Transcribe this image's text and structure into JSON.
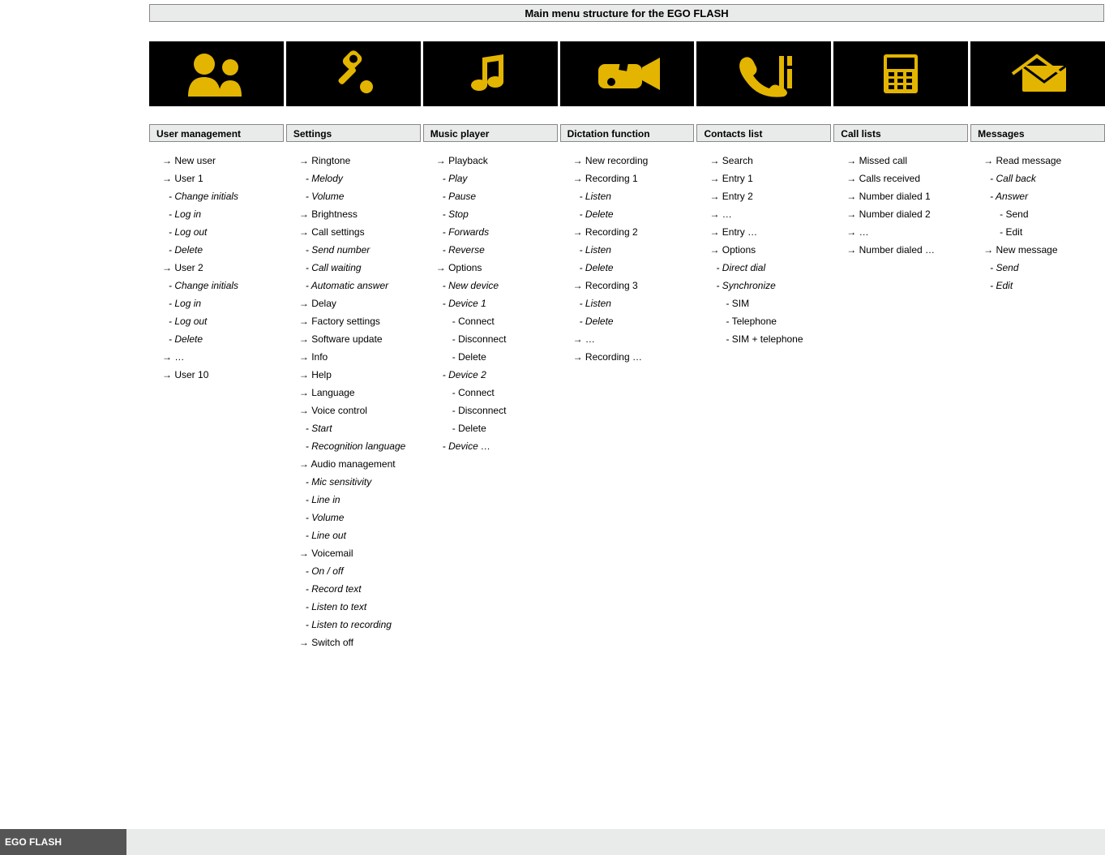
{
  "title": "Main menu structure for the EGO FLASH",
  "footer_label": "EGO FLASH",
  "sections": [
    {
      "header": "User management",
      "icon": "users-icon",
      "items": [
        {
          "t": "New user",
          "l": 0,
          "k": "arrow"
        },
        {
          "t": "User 1",
          "l": 0,
          "k": "arrow"
        },
        {
          "t": "Change initials",
          "l": 1,
          "k": "dash"
        },
        {
          "t": "Log in",
          "l": 1,
          "k": "dash"
        },
        {
          "t": "Log out",
          "l": 1,
          "k": "dash"
        },
        {
          "t": "Delete",
          "l": 1,
          "k": "dash"
        },
        {
          "t": "User 2",
          "l": 0,
          "k": "arrow"
        },
        {
          "t": "Change initials",
          "l": 1,
          "k": "dash"
        },
        {
          "t": "Log in",
          "l": 1,
          "k": "dash"
        },
        {
          "t": "Log out",
          "l": 1,
          "k": "dash"
        },
        {
          "t": "Delete",
          "l": 1,
          "k": "dash"
        },
        {
          "t": "…",
          "l": 0,
          "k": "arrow"
        },
        {
          "t": "User 10",
          "l": 0,
          "k": "arrow"
        }
      ]
    },
    {
      "header": "Settings",
      "icon": "settings-icon",
      "items": [
        {
          "t": "Ringtone",
          "l": 0,
          "k": "arrow"
        },
        {
          "t": "Melody",
          "l": 1,
          "k": "dash"
        },
        {
          "t": "Volume",
          "l": 1,
          "k": "dash"
        },
        {
          "t": "Brightness",
          "l": 0,
          "k": "arrow"
        },
        {
          "t": "Call settings",
          "l": 0,
          "k": "arrow"
        },
        {
          "t": "Send number",
          "l": 1,
          "k": "dash"
        },
        {
          "t": "Call waiting",
          "l": 1,
          "k": "dash"
        },
        {
          "t": "Automatic answer",
          "l": 1,
          "k": "dash"
        },
        {
          "t": "Delay",
          "l": 0,
          "k": "arrow"
        },
        {
          "t": "Factory settings",
          "l": 0,
          "k": "arrow"
        },
        {
          "t": "Software update",
          "l": 0,
          "k": "arrow"
        },
        {
          "t": "Info",
          "l": 0,
          "k": "arrow"
        },
        {
          "t": "Help",
          "l": 0,
          "k": "arrow"
        },
        {
          "t": "Language",
          "l": 0,
          "k": "arrow"
        },
        {
          "t": "Voice control",
          "l": 0,
          "k": "arrow"
        },
        {
          "t": "Start",
          "l": 1,
          "k": "dash"
        },
        {
          "t": "Recognition language",
          "l": 1,
          "k": "dash"
        },
        {
          "t": "Audio management",
          "l": 0,
          "k": "arrow"
        },
        {
          "t": "Mic sensitivity",
          "l": 1,
          "k": "dash"
        },
        {
          "t": "Line in",
          "l": 1,
          "k": "dash"
        },
        {
          "t": "Volume",
          "l": 1,
          "k": "dash"
        },
        {
          "t": "Line out",
          "l": 1,
          "k": "dash"
        },
        {
          "t": "Voicemail",
          "l": 0,
          "k": "arrow"
        },
        {
          "t": "On / off",
          "l": 1,
          "k": "dash"
        },
        {
          "t": "Record text",
          "l": 1,
          "k": "dash"
        },
        {
          "t": "Listen to text",
          "l": 1,
          "k": "dash"
        },
        {
          "t": "Listen to recording",
          "l": 1,
          "k": "dash"
        },
        {
          "t": "Switch off",
          "l": 0,
          "k": "arrow"
        }
      ]
    },
    {
      "header": "Music player",
      "icon": "music-icon",
      "items": [
        {
          "t": "Playback",
          "l": 0,
          "k": "arrow"
        },
        {
          "t": "Play",
          "l": 1,
          "k": "dash"
        },
        {
          "t": "Pause",
          "l": 1,
          "k": "dash"
        },
        {
          "t": "Stop",
          "l": 1,
          "k": "dash"
        },
        {
          "t": "Forwards",
          "l": 1,
          "k": "dash"
        },
        {
          "t": "Reverse",
          "l": 1,
          "k": "dash"
        },
        {
          "t": "Options",
          "l": 0,
          "k": "arrow"
        },
        {
          "t": "New device",
          "l": 1,
          "k": "dash"
        },
        {
          "t": "Device 1",
          "l": 1,
          "k": "dash"
        },
        {
          "t": "Connect",
          "l": 2,
          "k": "dash"
        },
        {
          "t": "Disconnect",
          "l": 2,
          "k": "dash"
        },
        {
          "t": "Delete",
          "l": 2,
          "k": "dash"
        },
        {
          "t": "Device 2",
          "l": 1,
          "k": "dash"
        },
        {
          "t": "Connect",
          "l": 2,
          "k": "dash"
        },
        {
          "t": "Disconnect",
          "l": 2,
          "k": "dash"
        },
        {
          "t": "Delete",
          "l": 2,
          "k": "dash"
        },
        {
          "t": "Device …",
          "l": 1,
          "k": "dash"
        }
      ]
    },
    {
      "header": "Dictation function",
      "icon": "dictation-icon",
      "items": [
        {
          "t": "New recording",
          "l": 0,
          "k": "arrow"
        },
        {
          "t": "Recording 1",
          "l": 0,
          "k": "arrow"
        },
        {
          "t": "Listen",
          "l": 1,
          "k": "dash"
        },
        {
          "t": "Delete",
          "l": 1,
          "k": "dash"
        },
        {
          "t": "Recording 2",
          "l": 0,
          "k": "arrow"
        },
        {
          "t": "Listen",
          "l": 1,
          "k": "dash"
        },
        {
          "t": "Delete",
          "l": 1,
          "k": "dash"
        },
        {
          "t": "Recording 3",
          "l": 0,
          "k": "arrow"
        },
        {
          "t": "Listen",
          "l": 1,
          "k": "dash"
        },
        {
          "t": "Delete",
          "l": 1,
          "k": "dash"
        },
        {
          "t": "…",
          "l": 0,
          "k": "arrow"
        },
        {
          "t": "Recording …",
          "l": 0,
          "k": "arrow"
        }
      ]
    },
    {
      "header": "Contacts list",
      "icon": "phone-icon",
      "items": [
        {
          "t": "Search",
          "l": 0,
          "k": "arrow"
        },
        {
          "t": "Entry 1",
          "l": 0,
          "k": "arrow"
        },
        {
          "t": "Entry 2",
          "l": 0,
          "k": "arrow"
        },
        {
          "t": "…",
          "l": 0,
          "k": "arrow"
        },
        {
          "t": "Entry …",
          "l": 0,
          "k": "arrow"
        },
        {
          "t": "Options",
          "l": 0,
          "k": "arrow"
        },
        {
          "t": "Direct dial",
          "l": 1,
          "k": "dash"
        },
        {
          "t": "Synchronize",
          "l": 1,
          "k": "dash"
        },
        {
          "t": "SIM",
          "l": 2,
          "k": "dash"
        },
        {
          "t": "Telephone",
          "l": 2,
          "k": "dash"
        },
        {
          "t": "SIM + telephone",
          "l": 2,
          "k": "dash"
        }
      ]
    },
    {
      "header": "Call lists",
      "icon": "keypad-icon",
      "items": [
        {
          "t": "Missed call",
          "l": 0,
          "k": "arrow"
        },
        {
          "t": "Calls received",
          "l": 0,
          "k": "arrow"
        },
        {
          "t": "Number dialed 1",
          "l": 0,
          "k": "arrow"
        },
        {
          "t": "Number dialed 2",
          "l": 0,
          "k": "arrow"
        },
        {
          "t": "…",
          "l": 0,
          "k": "arrow"
        },
        {
          "t": "Number dialed …",
          "l": 0,
          "k": "arrow"
        }
      ]
    },
    {
      "header": "Messages",
      "icon": "messages-icon",
      "items": [
        {
          "t": "Read message",
          "l": 0,
          "k": "arrow"
        },
        {
          "t": "Call back",
          "l": 1,
          "k": "dash"
        },
        {
          "t": "Answer",
          "l": 1,
          "k": "dash"
        },
        {
          "t": "Send",
          "l": 2,
          "k": "dash"
        },
        {
          "t": "Edit",
          "l": 2,
          "k": "dash"
        },
        {
          "t": "New message",
          "l": 0,
          "k": "arrow"
        },
        {
          "t": "Send",
          "l": 1,
          "k": "dash"
        },
        {
          "t": "Edit",
          "l": 1,
          "k": "dash"
        }
      ]
    }
  ],
  "colors": {
    "accent": "#E3B500",
    "panel": "#e9eaea"
  }
}
